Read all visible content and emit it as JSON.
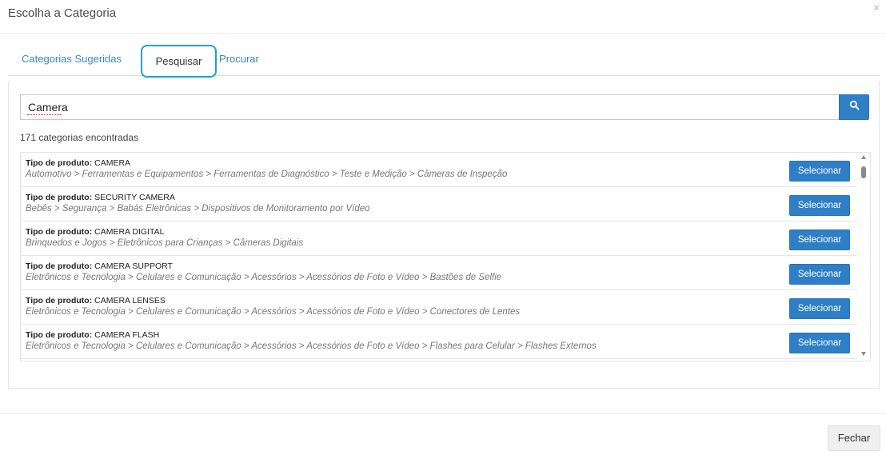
{
  "modal": {
    "title": "Escolha a Categoria",
    "close_glyph": "×"
  },
  "tabs": [
    {
      "label": "Categorias Sugeridas",
      "active": false
    },
    {
      "label": "Pesquisar",
      "active": true
    },
    {
      "label": "Procurar",
      "active": false
    }
  ],
  "search": {
    "value": "Camera",
    "placeholder": "",
    "button_icon": "search-icon"
  },
  "results_count": "171 categorias encontradas",
  "type_prefix": "Tipo de produto:",
  "select_label": "Selecionar",
  "rows": [
    {
      "type": "CAMERA",
      "path": "Automotivo > Ferramentas e Equipamentos > Ferramentas de Diagnóstico > Teste e Medição > Câmeras de Inspeção"
    },
    {
      "type": "SECURITY CAMERA",
      "path": "Bebês > Segurança > Babás Eletrônicas > Dispositivos de Monitoramento por Vídeo"
    },
    {
      "type": "CAMERA DIGITAL",
      "path": "Brinquedos e Jogos > Eletrônicos para Crianças > Câmeras Digitais"
    },
    {
      "type": "CAMERA SUPPORT",
      "path": "Eletrônicos e Tecnologia > Celulares e Comunicação > Acessórios > Acessórios de Foto e Vídeo > Bastões de Selfie"
    },
    {
      "type": "CAMERA LENSES",
      "path": "Eletrônicos e Tecnologia > Celulares e Comunicação > Acessórios > Acessórios de Foto e Vídeo > Conectores de Lentes"
    },
    {
      "type": "CAMERA FLASH",
      "path": "Eletrônicos e Tecnologia > Celulares e Comunicação > Acessórios > Acessórios de Foto e Vídeo > Flashes para Celular > Flashes Externos"
    }
  ],
  "footer": {
    "close_label": "Fechar"
  },
  "colors": {
    "accent": "#2f7fc6",
    "tab_link": "#3a86c8",
    "highlight_outline": "#1f9fe0"
  }
}
